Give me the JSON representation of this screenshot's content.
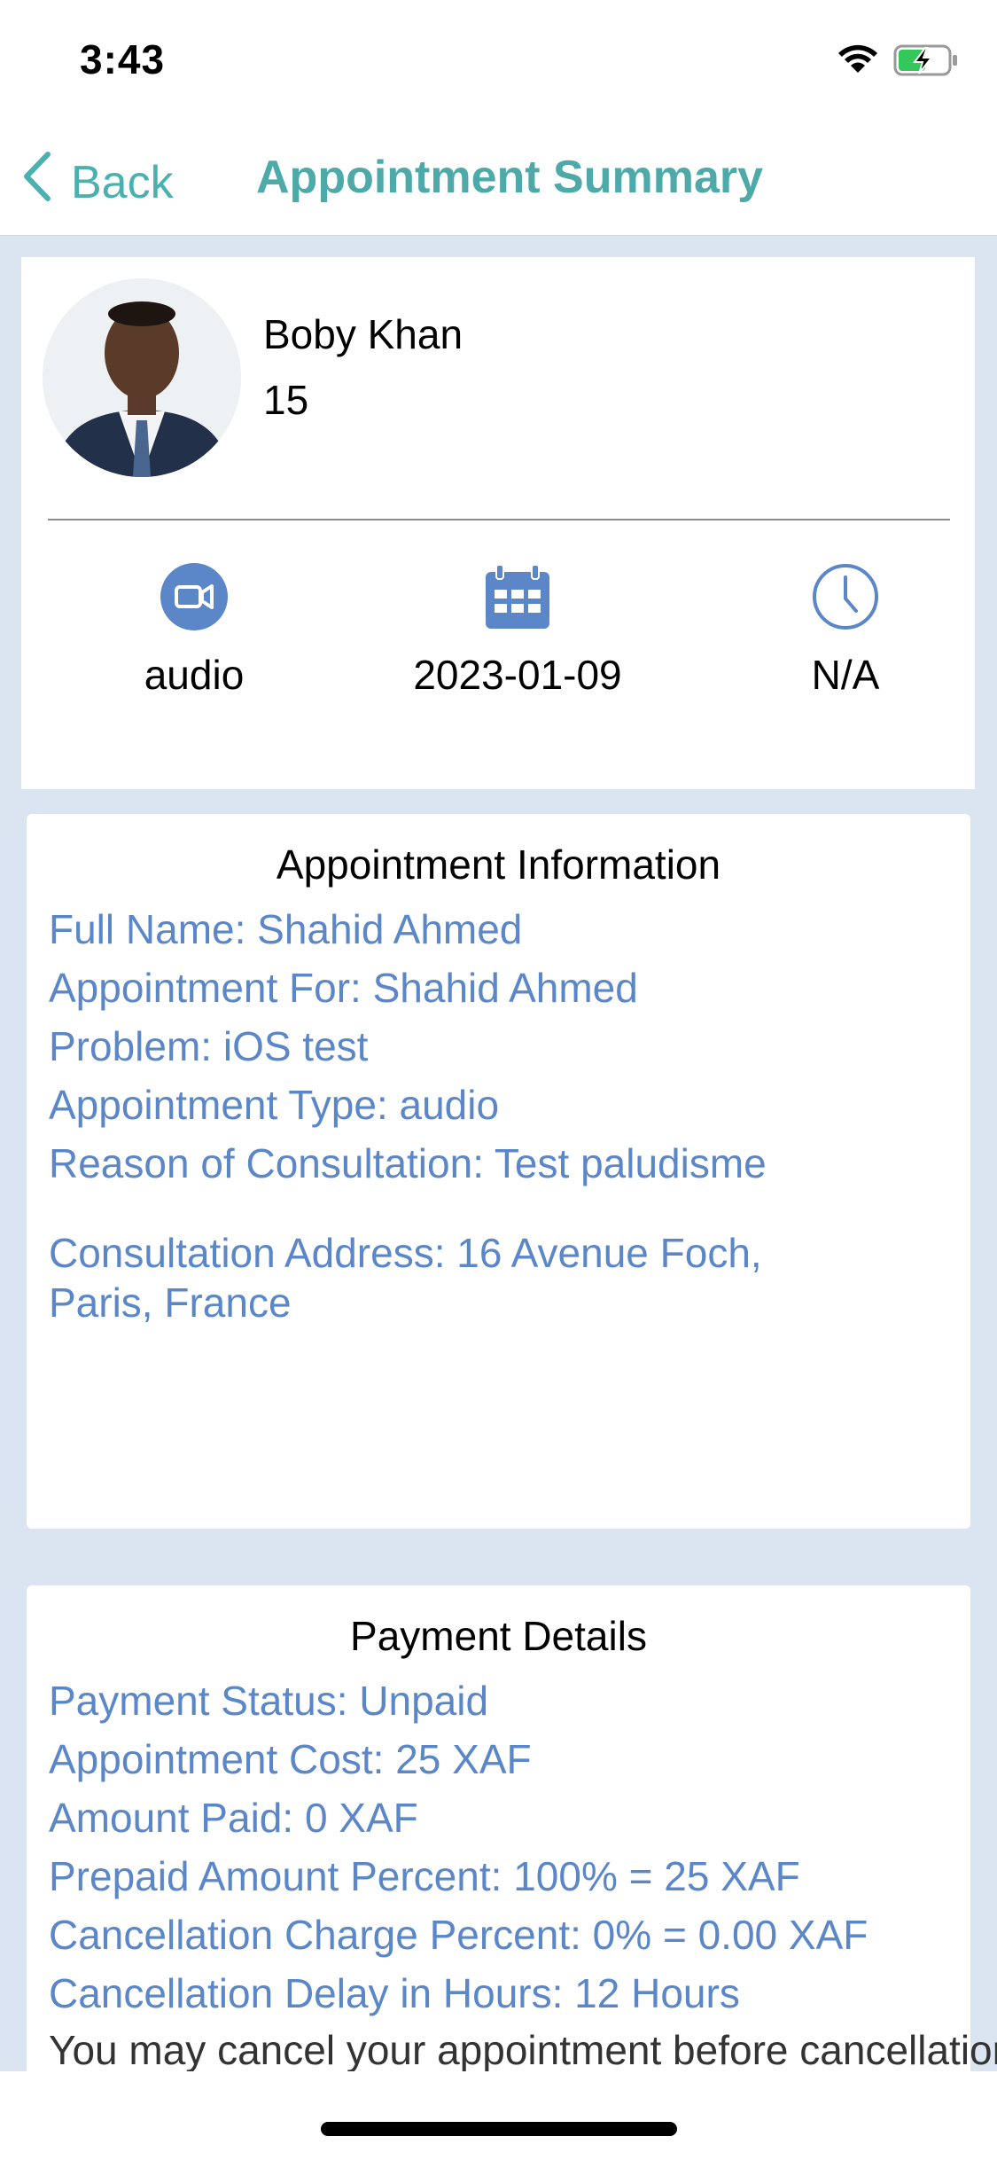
{
  "status_bar": {
    "time": "3:43"
  },
  "nav": {
    "back_label": "Back",
    "title": "Appointment Summary"
  },
  "doctor": {
    "name": "Boby Khan",
    "sub": "15",
    "type": "audio",
    "date": "2023-01-09",
    "time": "N/A"
  },
  "appointment_info": {
    "title": "Appointment Information",
    "full_name": "Full Name: Shahid Ahmed",
    "appointment_for": "Appointment For: Shahid Ahmed",
    "problem": "Problem: iOS test",
    "appointment_type": "Appointment Type: audio",
    "reason": "Reason of Consultation: Test paludisme",
    "address_line1": "Consultation Address: 16 Avenue Foch,",
    "address_line2": "Paris, France"
  },
  "payment": {
    "title": "Payment Details",
    "status": "Payment Status: Unpaid",
    "cost": "Appointment Cost: 25 XAF",
    "paid": "Amount Paid: 0 XAF",
    "prepaid": "Prepaid Amount Percent: 100% = 25 XAF",
    "cancellation_charge": "Cancellation Charge Percent: 0% = 0.00 XAF",
    "cancellation_delay": "Cancellation Delay in Hours: 12 Hours",
    "note": "You may cancel your appointment before cancellation"
  },
  "colors": {
    "accent": "#4eaaa8",
    "link": "#5b87c8",
    "icon_blue": "#5b87c8",
    "background": "#dbe5f1"
  },
  "icons": [
    "wifi-icon",
    "battery-charging-icon",
    "chevron-left-icon",
    "video-camera-icon",
    "calendar-icon",
    "clock-icon"
  ]
}
